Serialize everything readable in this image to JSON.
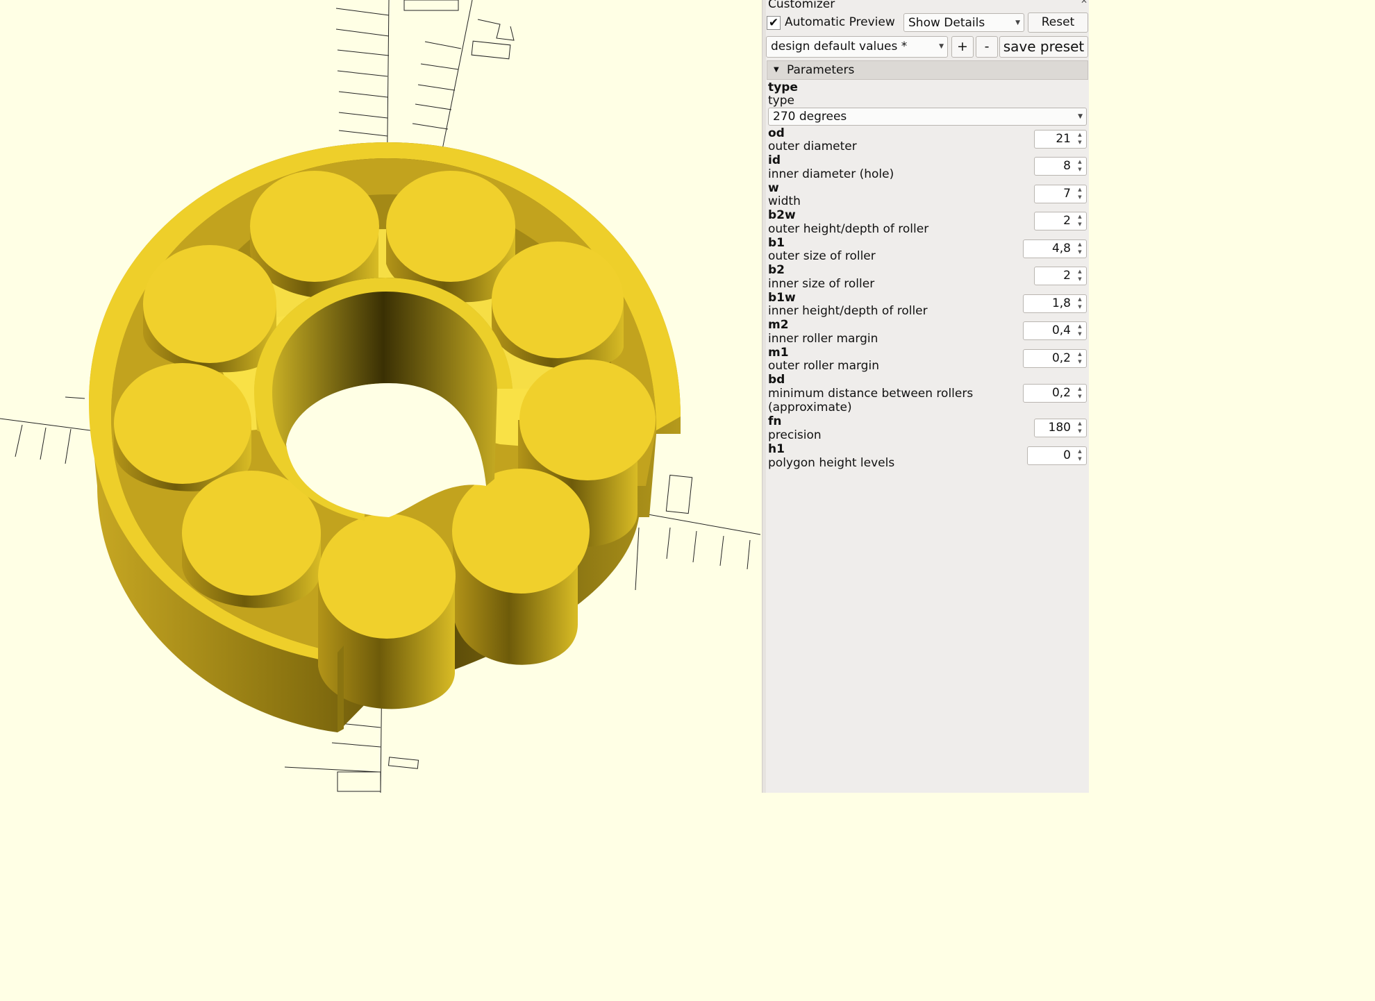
{
  "customizer": {
    "title": "Customizer",
    "automatic_preview_checked": true,
    "automatic_preview_label": "Automatic Preview",
    "details_select": "Show Details",
    "reset_label": "Reset",
    "preset_select": "design default values *",
    "add_preset_label": "+",
    "remove_preset_label": "-",
    "save_preset_label": "save preset",
    "section_title": "Parameters"
  },
  "parameters": {
    "type": {
      "name": "type",
      "desc": "type",
      "value": "270 degrees"
    },
    "od": {
      "name": "od",
      "desc": "outer diameter",
      "value": "21"
    },
    "id": {
      "name": "id",
      "desc": "inner diameter (hole)",
      "value": "8"
    },
    "w": {
      "name": "w",
      "desc": "width",
      "value": "7"
    },
    "b2w": {
      "name": "b2w",
      "desc": "outer height/depth of roller",
      "value": "2"
    },
    "b1": {
      "name": "b1",
      "desc": "outer size of roller",
      "value": "4,8"
    },
    "b2": {
      "name": "b2",
      "desc": "inner size of roller",
      "value": "2"
    },
    "b1w": {
      "name": "b1w",
      "desc": "inner height/depth of roller",
      "value": "1,8"
    },
    "m2": {
      "name": "m2",
      "desc": "inner roller margin",
      "value": "0,4"
    },
    "m1": {
      "name": "m1",
      "desc": "outer roller margin",
      "value": "0,2"
    },
    "bd": {
      "name": "bd",
      "desc_line1": "minimum distance between rollers",
      "desc_line2": "(approximate)",
      "value": "0,2"
    },
    "fn": {
      "name": "fn",
      "desc": "precision",
      "value": "180"
    },
    "h1": {
      "name": "h1",
      "desc": "polygon height levels",
      "value": "0"
    }
  },
  "colors": {
    "viewport_bg": "#ffffe5",
    "model_top": "#f1d22b",
    "model_side": "#c5a520",
    "panel_bg": "#efedeb"
  },
  "icons": {
    "checkbox": "checkmark-icon",
    "section_toggle": "triangle-down-icon",
    "dropdown": "chevron-down-icon",
    "spin": "spin-arrows-icon"
  }
}
